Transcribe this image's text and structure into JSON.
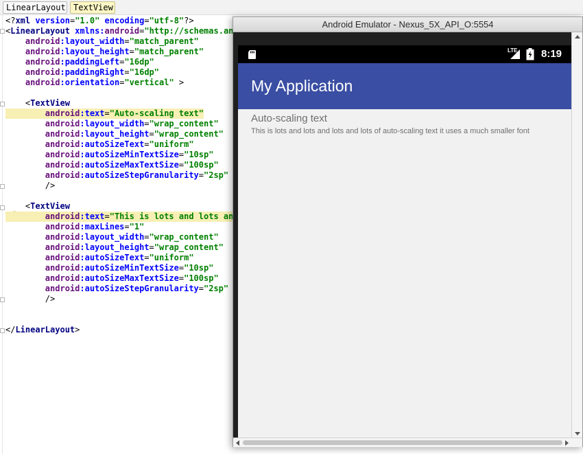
{
  "breadcrumb": {
    "items": [
      {
        "label": "LinearLayout"
      },
      {
        "label": "TextView"
      }
    ]
  },
  "editor": {
    "lines": [
      [
        [
          "decl",
          "<?"
        ],
        [
          "tag",
          "xml"
        ],
        [
          "punct",
          " "
        ],
        [
          "ns",
          "version"
        ],
        [
          "punct",
          "="
        ],
        [
          "val",
          "\"1.0\""
        ],
        [
          "punct",
          " "
        ],
        [
          "ns",
          "encoding"
        ],
        [
          "punct",
          "="
        ],
        [
          "val",
          "\"utf-8\""
        ],
        [
          "decl",
          "?>"
        ]
      ],
      [
        [
          "punct",
          "<"
        ],
        [
          "tag",
          "LinearLayout"
        ],
        [
          "punct",
          " "
        ],
        [
          "ns",
          "xmlns:"
        ],
        [
          "attr",
          "android"
        ],
        [
          "punct",
          "="
        ],
        [
          "val",
          "\"http://schemas.andr"
        ]
      ],
      [
        [
          "punct",
          "    "
        ],
        [
          "attr",
          "android"
        ],
        [
          "ns",
          ":layout_width"
        ],
        [
          "punct",
          "="
        ],
        [
          "val",
          "\"match_parent\""
        ]
      ],
      [
        [
          "punct",
          "    "
        ],
        [
          "attr",
          "android"
        ],
        [
          "ns",
          ":layout_height"
        ],
        [
          "punct",
          "="
        ],
        [
          "val",
          "\"match_parent\""
        ]
      ],
      [
        [
          "punct",
          "    "
        ],
        [
          "attr",
          "android"
        ],
        [
          "ns",
          ":paddingLeft"
        ],
        [
          "punct",
          "="
        ],
        [
          "val",
          "\"16dp\""
        ]
      ],
      [
        [
          "punct",
          "    "
        ],
        [
          "attr",
          "android"
        ],
        [
          "ns",
          ":paddingRight"
        ],
        [
          "punct",
          "="
        ],
        [
          "val",
          "\"16dp\""
        ]
      ],
      [
        [
          "punct",
          "    "
        ],
        [
          "attr",
          "android"
        ],
        [
          "ns",
          ":orientation"
        ],
        [
          "punct",
          "="
        ],
        [
          "val",
          "\"vertical\""
        ],
        [
          "punct",
          " >"
        ]
      ],
      [],
      [
        [
          "punct",
          "    <"
        ],
        [
          "tag",
          "TextView"
        ]
      ],
      [
        [
          "punct",
          "        "
        ],
        [
          "attr",
          "android"
        ],
        [
          "ns",
          ":text"
        ],
        [
          "punct",
          "="
        ],
        [
          "val",
          "\"Auto-scaling text\""
        ]
      ],
      [
        [
          "punct",
          "        "
        ],
        [
          "attr",
          "android"
        ],
        [
          "ns",
          ":layout_width"
        ],
        [
          "punct",
          "="
        ],
        [
          "val",
          "\"wrap_content\""
        ]
      ],
      [
        [
          "punct",
          "        "
        ],
        [
          "attr",
          "android"
        ],
        [
          "ns",
          ":layout_height"
        ],
        [
          "punct",
          "="
        ],
        [
          "val",
          "\"wrap_content\""
        ]
      ],
      [
        [
          "punct",
          "        "
        ],
        [
          "attr",
          "android"
        ],
        [
          "ns",
          ":autoSizeText"
        ],
        [
          "punct",
          "="
        ],
        [
          "val",
          "\"uniform\""
        ]
      ],
      [
        [
          "punct",
          "        "
        ],
        [
          "attr",
          "android"
        ],
        [
          "ns",
          ":autoSizeMinTextSize"
        ],
        [
          "punct",
          "="
        ],
        [
          "val",
          "\"10sp\""
        ]
      ],
      [
        [
          "punct",
          "        "
        ],
        [
          "attr",
          "android"
        ],
        [
          "ns",
          ":autoSizeMaxTextSize"
        ],
        [
          "punct",
          "="
        ],
        [
          "val",
          "\"100sp\""
        ]
      ],
      [
        [
          "punct",
          "        "
        ],
        [
          "attr",
          "android"
        ],
        [
          "ns",
          ":autoSizeStepGranularity"
        ],
        [
          "punct",
          "="
        ],
        [
          "val",
          "\"2sp\""
        ]
      ],
      [
        [
          "punct",
          "        />"
        ]
      ],
      [],
      [
        [
          "punct",
          "    <"
        ],
        [
          "tag",
          "TextView"
        ]
      ],
      [
        [
          "punct",
          "        "
        ],
        [
          "attr",
          "android"
        ],
        [
          "ns",
          ":text"
        ],
        [
          "punct",
          "="
        ],
        [
          "val",
          "\"This is lots and lots and"
        ]
      ],
      [
        [
          "punct",
          "        "
        ],
        [
          "attr",
          "android"
        ],
        [
          "ns",
          ":maxLines"
        ],
        [
          "punct",
          "="
        ],
        [
          "val",
          "\"1\""
        ]
      ],
      [
        [
          "punct",
          "        "
        ],
        [
          "attr",
          "android"
        ],
        [
          "ns",
          ":layout_width"
        ],
        [
          "punct",
          "="
        ],
        [
          "val",
          "\"wrap_content\""
        ]
      ],
      [
        [
          "punct",
          "        "
        ],
        [
          "attr",
          "android"
        ],
        [
          "ns",
          ":layout_height"
        ],
        [
          "punct",
          "="
        ],
        [
          "val",
          "\"wrap_content\""
        ]
      ],
      [
        [
          "punct",
          "        "
        ],
        [
          "attr",
          "android"
        ],
        [
          "ns",
          ":autoSizeText"
        ],
        [
          "punct",
          "="
        ],
        [
          "val",
          "\"uniform\""
        ]
      ],
      [
        [
          "punct",
          "        "
        ],
        [
          "attr",
          "android"
        ],
        [
          "ns",
          ":autoSizeMinTextSize"
        ],
        [
          "punct",
          "="
        ],
        [
          "val",
          "\"10sp\""
        ]
      ],
      [
        [
          "punct",
          "        "
        ],
        [
          "attr",
          "android"
        ],
        [
          "ns",
          ":autoSizeMaxTextSize"
        ],
        [
          "punct",
          "="
        ],
        [
          "val",
          "\"100sp\""
        ]
      ],
      [
        [
          "punct",
          "        "
        ],
        [
          "attr",
          "android"
        ],
        [
          "ns",
          ":autoSizeStepGranularity"
        ],
        [
          "punct",
          "="
        ],
        [
          "val",
          "\"2sp\""
        ]
      ],
      [
        [
          "punct",
          "        />"
        ]
      ],
      [],
      [],
      [
        [
          "punct",
          "</"
        ],
        [
          "tag",
          "LinearLayout"
        ],
        [
          "punct",
          ">"
        ]
      ]
    ]
  },
  "emulator": {
    "window_title": "Android Emulator - Nexus_5X_API_O:5554",
    "status_bar": {
      "network": "LTE",
      "time": "8:19"
    },
    "app_bar": {
      "title": "My Application"
    },
    "text_view_1": "Auto-scaling text",
    "text_view_2": "This is lots and lots and lots and lots of auto-scaling text it uses a much smaller font"
  },
  "colors": {
    "app_bar": "#3a4ea3",
    "highlight": "#f7efb4",
    "xml_tag": "#000080",
    "xml_attr_prefix": "#660e7a",
    "xml_attr_name": "#0000ff",
    "xml_value": "#008000"
  },
  "icons": [
    "sd-card-icon",
    "signal-icon",
    "battery-charging-icon",
    "lightbulb-icon",
    "fold-icon"
  ]
}
